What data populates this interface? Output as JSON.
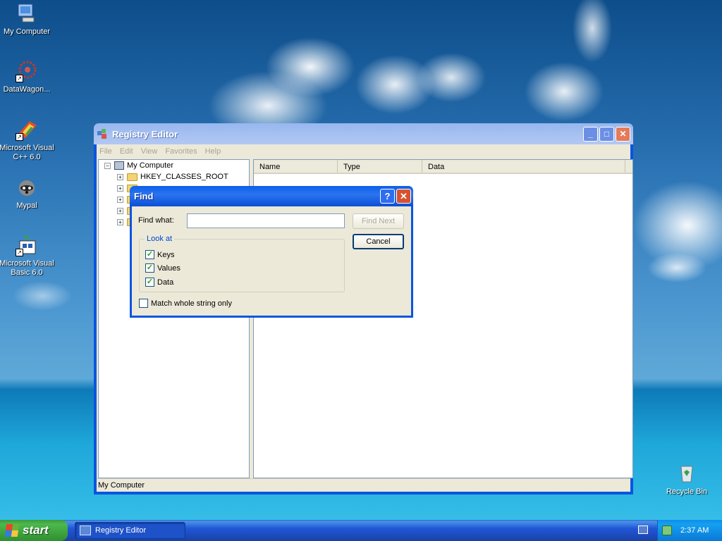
{
  "desktop": {
    "icons": [
      {
        "label": "My Computer"
      },
      {
        "label": "DataWagon..."
      },
      {
        "label": "Microsoft Visual C++ 6.0"
      },
      {
        "label": "Mypal"
      },
      {
        "label": "Microsoft Visual Basic 6.0"
      },
      {
        "label": "Recycle Bin"
      }
    ]
  },
  "regedit": {
    "title": "Registry Editor",
    "menu": [
      "File",
      "Edit",
      "View",
      "Favorites",
      "Help"
    ],
    "tree": {
      "root": "My Computer",
      "keys": [
        "HKEY_CLASSES_ROOT"
      ]
    },
    "columns": [
      "Name",
      "Type",
      "Data"
    ],
    "status": "My Computer"
  },
  "find_dialog": {
    "title": "Find",
    "find_what_label": "Find what:",
    "find_what_value": "",
    "find_next_label": "Find Next",
    "cancel_label": "Cancel",
    "look_at_label": "Look at",
    "checks": [
      {
        "label": "Keys",
        "checked": true
      },
      {
        "label": "Values",
        "checked": true
      },
      {
        "label": "Data",
        "checked": true
      }
    ],
    "match_whole_label": "Match whole string only",
    "match_whole_checked": false
  },
  "taskbar": {
    "start_label": "start",
    "task_label": "Registry Editor",
    "clock": "2:37 AM"
  }
}
